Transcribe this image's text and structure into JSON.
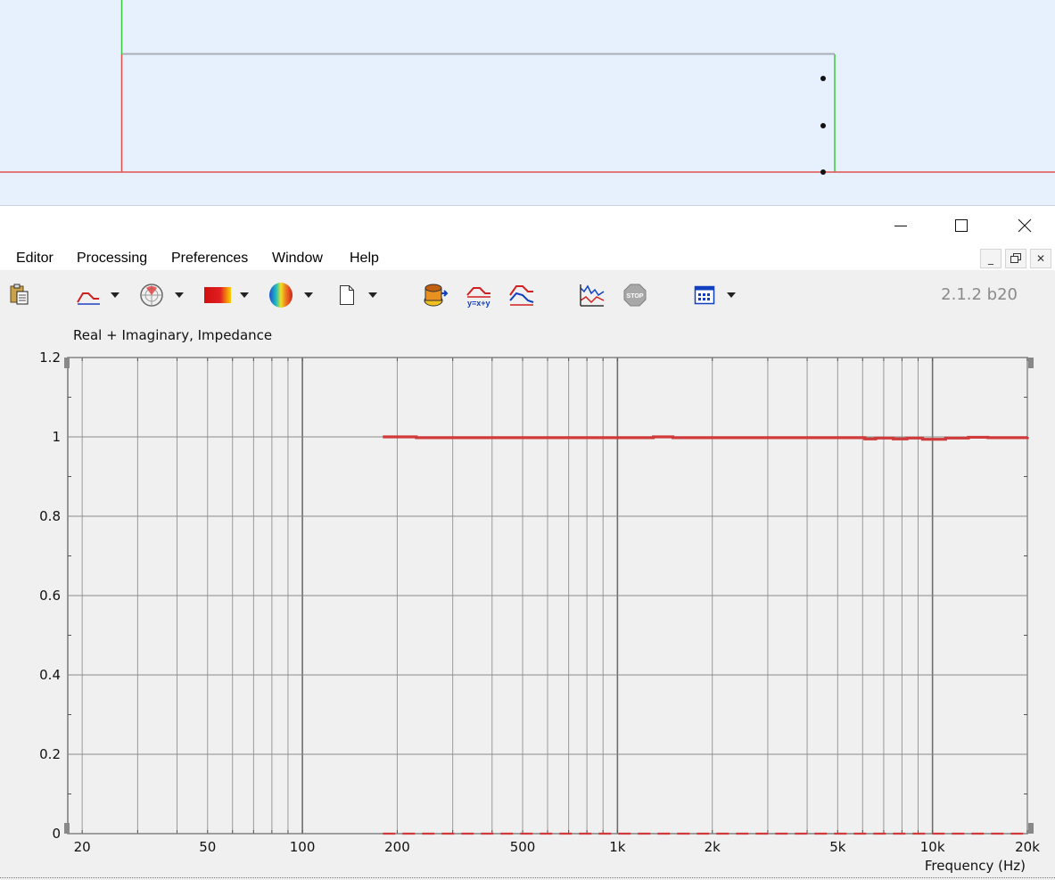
{
  "window_controls": {
    "minimize": "minimize",
    "maximize": "maximize",
    "close": "close"
  },
  "menu": {
    "items": [
      "Editor",
      "Processing",
      "Preferences",
      "Window",
      "Help"
    ]
  },
  "toolbar": {
    "version": "2.1.2 b20"
  },
  "colors": {
    "trace_red": "#d03a3a",
    "grid": "#8c8c8c",
    "top_pane_bg": "#e6f1fd",
    "wire_red": "#e0504c",
    "wire_green": "#3cc83c"
  },
  "chart_data": {
    "type": "line",
    "title": "Real + Imaginary, Impedance",
    "xlabel": "Frequency  (Hz)",
    "ylabel": "",
    "x_scale": "log",
    "xlim": [
      18,
      20000
    ],
    "ylim": [
      0,
      1.2
    ],
    "x_ticks": [
      20,
      50,
      100,
      200,
      500,
      1000,
      2000,
      5000,
      10000,
      20000
    ],
    "x_tick_labels": [
      "20",
      "50",
      "100",
      "200",
      "500",
      "1k",
      "2k",
      "5k",
      "10k",
      "20k"
    ],
    "y_ticks": [
      0,
      0.2,
      0.4,
      0.6,
      0.8,
      1.0,
      1.2
    ],
    "y_tick_labels": [
      "0",
      "0.2",
      "0.4",
      "0.6",
      "0.8",
      "1",
      "1.2"
    ],
    "grid": true,
    "series": [
      {
        "name": "",
        "x": [
          180,
          230,
          300,
          500,
          800,
          1050,
          1300,
          1500,
          2000,
          3000,
          5000,
          6100,
          6600,
          7500,
          8300,
          9300,
          11000,
          13000,
          15000,
          20000
        ],
        "y": [
          1.0,
          0.998,
          0.998,
          0.998,
          0.998,
          0.998,
          1.0,
          0.998,
          0.998,
          0.998,
          0.998,
          0.995,
          0.997,
          0.995,
          0.997,
          0.994,
          0.997,
          0.999,
          0.998,
          1.0
        ]
      },
      {
        "name": "",
        "x": [
          180,
          1000,
          2000,
          20000
        ],
        "y": [
          0,
          0,
          0,
          0
        ]
      }
    ]
  }
}
